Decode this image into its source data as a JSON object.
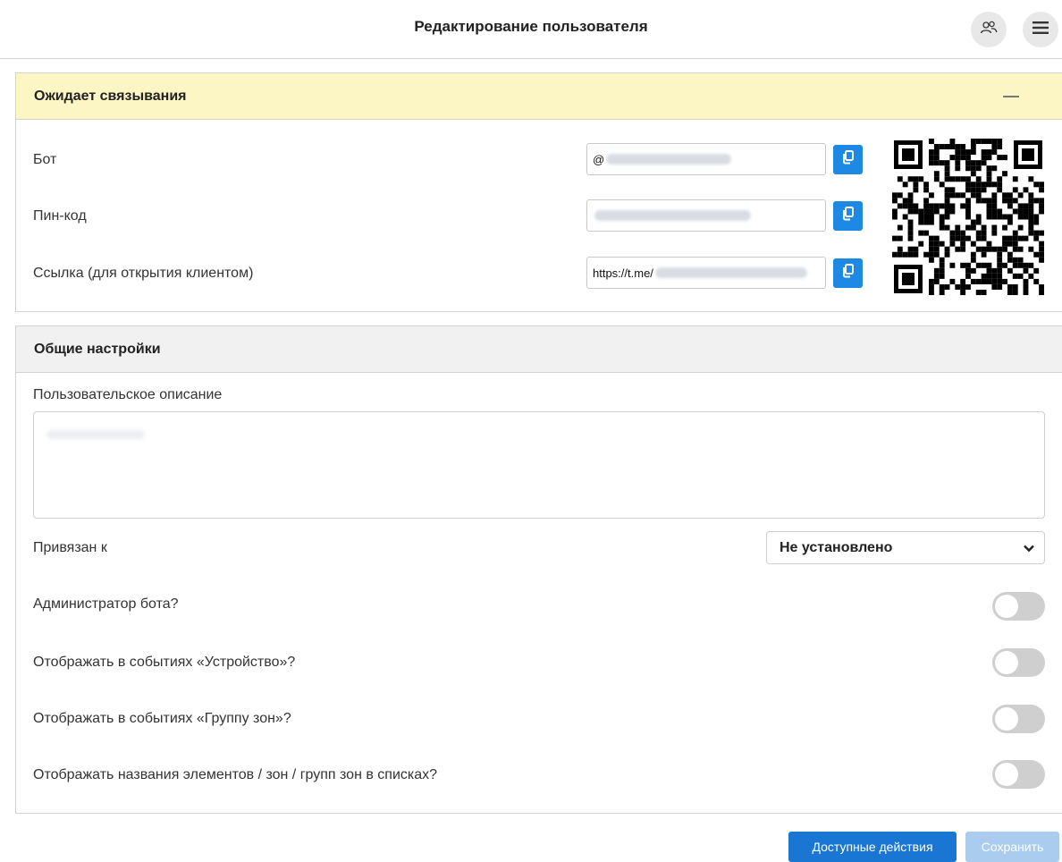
{
  "header": {
    "title": "Редактирование пользователя"
  },
  "linking": {
    "title": "Ожидает связывания",
    "bot_label": "Бот",
    "bot_value": "@",
    "pin_label": "Пин-код",
    "pin_value": "",
    "link_label": "Ссылка (для открытия клиентом)",
    "link_value": "https://t.me/"
  },
  "settings": {
    "title": "Общие настройки",
    "description_label": "Пользовательское описание",
    "description_value": "",
    "bound_to_label": "Привязан к",
    "bound_to_value": "Не установлено",
    "toggles": [
      {
        "label": "Администратор бота?",
        "on": false
      },
      {
        "label": "Отображать в событиях «Устройство»?",
        "on": false
      },
      {
        "label": "Отображать в событиях «Группу зон»?",
        "on": false
      },
      {
        "label": "Отображать названия элементов / зон / групп зон в списках?",
        "on": false
      }
    ]
  },
  "footer": {
    "actions_label": "Доступные действия",
    "save_label": "Сохранить"
  },
  "colors": {
    "primary": "#1976d2",
    "disabled_primary": "#a9ccef",
    "pending_header": "#fcf6c5"
  },
  "icons": [
    "users-icon",
    "menu-icon",
    "copy-icon",
    "qr-code",
    "chevron-down-icon",
    "collapse-icon"
  ]
}
